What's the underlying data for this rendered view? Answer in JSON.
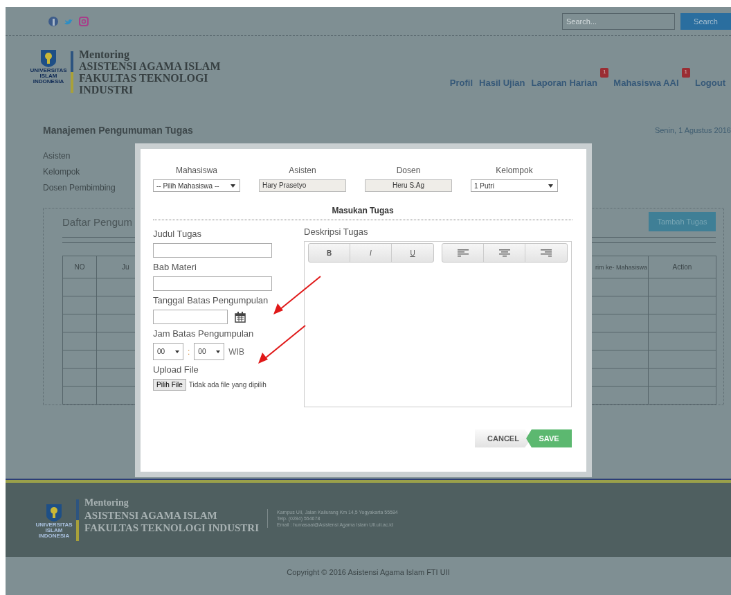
{
  "search": {
    "placeholder": "Search...",
    "button": "Search"
  },
  "logo_text": [
    "UNIVERSITAS",
    "ISLAM",
    "INDONESIA"
  ],
  "footer_logo_text": [
    "UNIVERSITAS",
    "ISLAM",
    "INDONESIA"
  ],
  "brand": [
    "Mentoring",
    "ASISTENSI AGAMA ISLAM",
    "FAKULTAS TEKNOLOGI",
    "INDUSTRI"
  ],
  "nav": [
    {
      "label": "Profil"
    },
    {
      "label": "Hasil Ujian"
    },
    {
      "label": "Laporan Harian",
      "badge": "1"
    },
    {
      "label": "Mahasiswa AAI",
      "badge": "1"
    },
    {
      "label": "Logout"
    }
  ],
  "page_title": "Manajemen Pengumuman Tugas",
  "date": "Senin, 1 Agustus 2016",
  "filters": [
    "Asisten",
    "Kelompok",
    "Dosen Pembimbing"
  ],
  "panel": {
    "title": "Daftar Pengum",
    "add_button": "Tambah Tugas",
    "columns": [
      "NO",
      "Ju",
      "rim ke- Mahasiswa",
      "Action"
    ]
  },
  "modal": {
    "header_fields": [
      {
        "label": "Mahasiswa",
        "kind": "select",
        "value": "-- Pilih Mahasiswa --"
      },
      {
        "label": "Asisten",
        "kind": "readonly",
        "value": "Hary Prasetyo"
      },
      {
        "label": "Dosen",
        "kind": "readonly",
        "value": "Heru S.Ag"
      },
      {
        "label": "Kelompok",
        "kind": "select",
        "value": "1 Putri"
      }
    ],
    "section_title": "Masukan Tugas",
    "fields": [
      {
        "label": "Judul Tugas",
        "kind": "text"
      },
      {
        "label": "Bab Materi",
        "kind": "text"
      },
      {
        "label": "Tanggal Batas Pengumpulan",
        "kind": "date"
      },
      {
        "label": "Jam Batas Pengumpulan",
        "kind": "time",
        "hour": "00",
        "separator": ":",
        "minute": "00",
        "suffix": "WIB"
      },
      {
        "label": "Upload File",
        "kind": "file",
        "button": "Pilih File",
        "status": "Tidak ada file yang dipilih"
      }
    ],
    "editor": {
      "label": "Deskripsi Tugas",
      "format_buttons": [
        {
          "label": "B",
          "kind": "bold"
        },
        {
          "label": "I",
          "kind": "italic"
        },
        {
          "label": "U",
          "kind": "underline"
        }
      ],
      "align_buttons": [
        {
          "kind": "left"
        },
        {
          "kind": "center"
        },
        {
          "kind": "right"
        }
      ]
    },
    "cancel": "CANCEL",
    "save": "SAVE"
  },
  "footer": {
    "brand": [
      "Mentoring",
      "ASISTENSI AGAMA ISLAM",
      "FAKULTAS TEKNOLOGI INDUSTRI"
    ],
    "address": [
      "Kampus UII, Jalan Kaliurang Km 14,5 Yogyakarta 55584",
      "Telp. (0284) 554678",
      "Email : humasaai@Asistensi Agama Islam UII.uii.ac.id"
    ],
    "copyright": "Copyright © 2016 Asistensi Agama Islam FTI UII"
  }
}
